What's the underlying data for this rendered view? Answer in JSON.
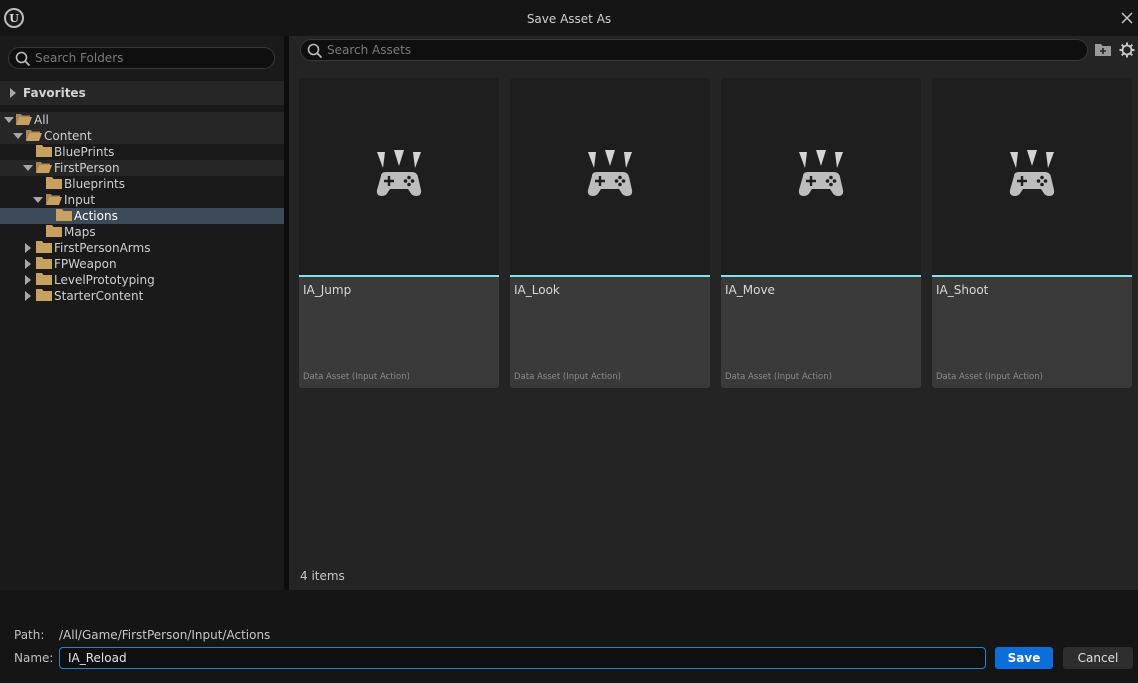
{
  "window": {
    "title": "Save Asset As",
    "logo_letter": "U"
  },
  "left_panel": {
    "search_placeholder": "Search Folders",
    "favorites_label": "Favorites",
    "tree": [
      {
        "label": "All"
      },
      {
        "label": "Content"
      },
      {
        "label": "BluePrints"
      },
      {
        "label": "FirstPerson"
      },
      {
        "label": "Blueprints"
      },
      {
        "label": "Input"
      },
      {
        "label": "Actions"
      },
      {
        "label": "Maps"
      },
      {
        "label": "FirstPersonArms"
      },
      {
        "label": "FPWeapon"
      },
      {
        "label": "LevelPrototyping"
      },
      {
        "label": "StarterContent"
      }
    ]
  },
  "right_panel": {
    "search_placeholder": "Search Assets",
    "assets": [
      {
        "name": "IA_Jump",
        "type": "Data Asset (Input Action)"
      },
      {
        "name": "IA_Look",
        "type": "Data Asset (Input Action)"
      },
      {
        "name": "IA_Move",
        "type": "Data Asset (Input Action)"
      },
      {
        "name": "IA_Shoot",
        "type": "Data Asset (Input Action)"
      }
    ],
    "item_count": "4 items"
  },
  "footer": {
    "path_label": "Path:",
    "path_value": "/All/Game/FirstPerson/Input/Actions",
    "name_label": "Name:",
    "name_value": "IA_Reload",
    "save_label": "Save",
    "cancel_label": "Cancel"
  },
  "colors": {
    "accent": "#7fe3ee",
    "save_button": "#0a6edb",
    "selection": "#3d4a5a",
    "folder": "#c8a060"
  }
}
